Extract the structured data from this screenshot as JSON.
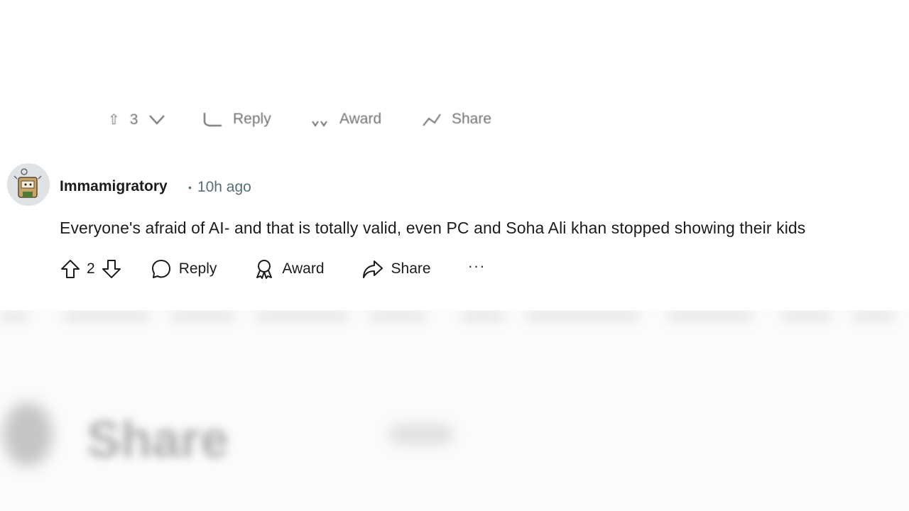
{
  "previous_comment_actions": {
    "vote_count": "3",
    "reply_label": "Reply",
    "award_label": "Award",
    "share_label": "Share"
  },
  "comment": {
    "author": "Immamigratory",
    "separator": "•",
    "time": "10h ago",
    "text": "Everyone's afraid of AI- and that is totally valid, even PC and Soha Ali khan stopped showing their kids",
    "vote_count": "2",
    "reply_label": "Reply",
    "award_label": "Award",
    "share_label": "Share",
    "more_label": "···"
  },
  "below": {
    "blurred_share_label": "Share"
  },
  "icons": [
    "upvote-icon",
    "downvote-icon",
    "reply-icon",
    "award-icon",
    "share-icon",
    "more-icon"
  ],
  "colors": {
    "text": "#1c1c1c",
    "meta": "#576f76",
    "avatar_bg": "#dfe3e5"
  }
}
